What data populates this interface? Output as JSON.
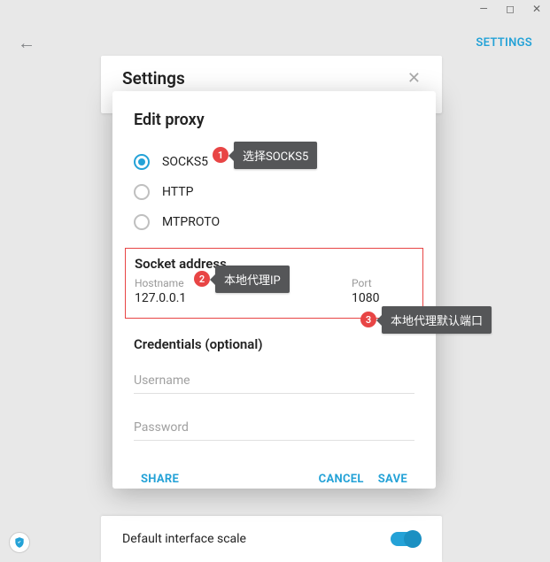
{
  "window": {
    "min": "—",
    "max": "◻",
    "close": "✕"
  },
  "topbar": {
    "back": "←",
    "settings": "SETTINGS"
  },
  "panel": {
    "title": "Settings"
  },
  "dialog": {
    "title": "Edit proxy",
    "radios": [
      "SOCKS5",
      "HTTP",
      "MTPROTO"
    ],
    "socket_title": "Socket address",
    "hostname_label": "Hostname",
    "hostname_value": "127.0.0.1",
    "port_label": "Port",
    "port_value": "1080",
    "cred_title": "Credentials (optional)",
    "username_ph": "Username",
    "password_ph": "Password",
    "share": "SHARE",
    "cancel": "CANCEL",
    "save": "SAVE"
  },
  "callouts": {
    "c1": "选择SOCKS5",
    "c2": "本地代理IP",
    "c3": "本地代理默认端口"
  },
  "bottom": {
    "label": "Default interface scale"
  }
}
